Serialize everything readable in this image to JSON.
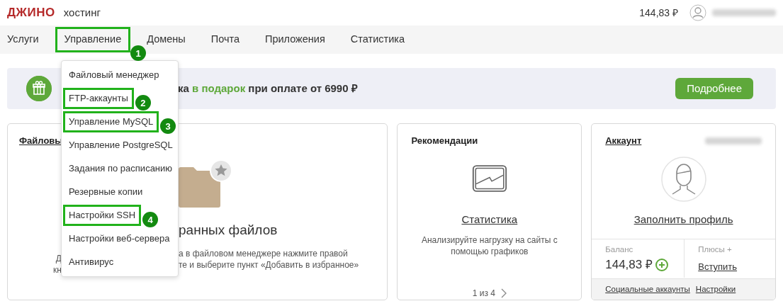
{
  "header": {
    "logo": "ДЖИНО",
    "product": "хостинг",
    "balance": "144,83 ₽"
  },
  "nav": [
    {
      "label": "Услуги",
      "highlighted": false
    },
    {
      "label": "Управление",
      "highlighted": true,
      "step": "1"
    },
    {
      "label": "Домены",
      "highlighted": false
    },
    {
      "label": "Почта",
      "highlighted": false
    },
    {
      "label": "Приложения",
      "highlighted": false
    },
    {
      "label": "Статистика",
      "highlighted": false
    }
  ],
  "menu": [
    {
      "label": "Файловый менеджер",
      "highlighted": false
    },
    {
      "label": "FTP-аккаунты",
      "highlighted": true,
      "step": "2"
    },
    {
      "label": "Управление MySQL",
      "highlighted": true,
      "step": "3"
    },
    {
      "label": "Управление PostgreSQL",
      "highlighted": false
    },
    {
      "label": "Задания по расписанию",
      "highlighted": false
    },
    {
      "label": "Резервные копии",
      "highlighted": false
    },
    {
      "label": "Настройки SSH",
      "highlighted": true,
      "step": "4"
    },
    {
      "label": "Настройки веб-сервера",
      "highlighted": false
    },
    {
      "label": "Антивирус",
      "highlighted": false
    }
  ],
  "banner": {
    "text": [
      {
        "text": "ка ",
        "accent": false
      },
      {
        "text": "в подарок",
        "accent": true
      },
      {
        "text": " при оплате от 6990 ₽",
        "accent": false
      }
    ],
    "button": "Подробнее"
  },
  "files_card": {
    "title": "Файловы",
    "heading": "ранных файлов",
    "text_lines": [
      {
        "left": "Д",
        "right": "а в файловом менеджере нажмите правой"
      },
      {
        "left": "кн",
        "right": "те и выберите пункт «Добавить в избранное»"
      }
    ]
  },
  "recommendations": {
    "title": "Рекомендации",
    "link": "Статистика",
    "description": "Анализируйте нагрузку на сайты с помощью графиков",
    "pager": "1 из 4"
  },
  "account": {
    "title": "Аккаунт",
    "profile_link": "Заполнить профиль",
    "balance_label": "Баланс",
    "balance": "144,83 ₽",
    "plus_label": "Плюсы +",
    "plus_link": "Вступить",
    "footer_links": [
      "Социальные аккаунты",
      "Настройки"
    ]
  }
}
